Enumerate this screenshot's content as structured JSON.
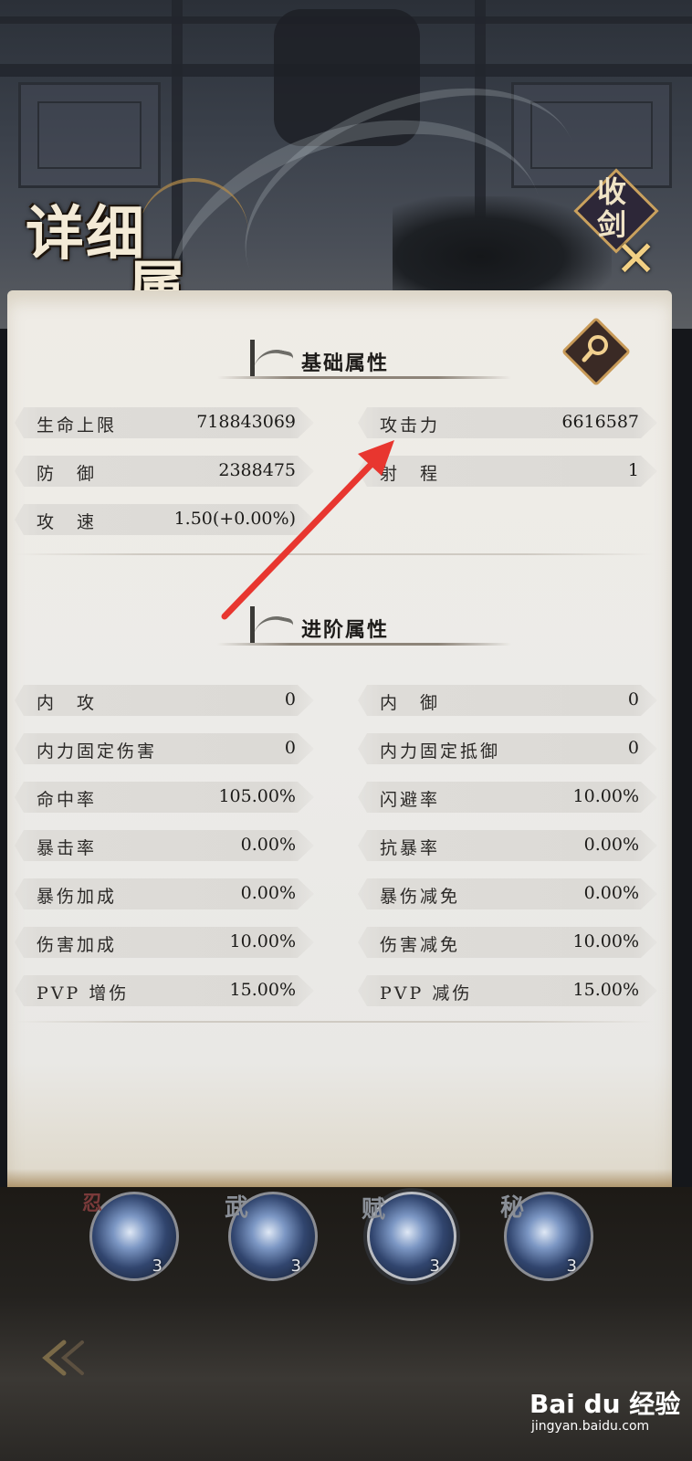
{
  "header": {
    "title_line1": "详细",
    "title_line2": "属性",
    "collapse_label": "收剑"
  },
  "basic": {
    "section_title": "基础属性",
    "rows": [
      {
        "label": "生命上限",
        "value": "718843069"
      },
      {
        "label": "攻击力",
        "value": "6616587"
      },
      {
        "label": "防　御",
        "value": "2388475"
      },
      {
        "label": "射　程",
        "value": "1"
      },
      {
        "label": "攻　速",
        "value": "1.50(+0.00%)"
      }
    ]
  },
  "advanced": {
    "section_title": "进阶属性",
    "rows": [
      {
        "label": "内　攻",
        "value": "0"
      },
      {
        "label": "内　御",
        "value": "0"
      },
      {
        "label": "内力固定伤害",
        "value": "0"
      },
      {
        "label": "内力固定抵御",
        "value": "0"
      },
      {
        "label": "命中率",
        "value": "105.00%"
      },
      {
        "label": "闪避率",
        "value": "10.00%"
      },
      {
        "label": "暴击率",
        "value": "0.00%"
      },
      {
        "label": "抗暴率",
        "value": "0.00%"
      },
      {
        "label": "暴伤加成",
        "value": "0.00%"
      },
      {
        "label": "暴伤减免",
        "value": "0.00%"
      },
      {
        "label": "伤害加成",
        "value": "10.00%"
      },
      {
        "label": "伤害减免",
        "value": "10.00%"
      },
      {
        "label": "PVP 增伤",
        "value": "15.00%"
      },
      {
        "label": "PVP 减伤",
        "value": "15.00%"
      }
    ]
  },
  "skills": [
    {
      "tag": "忍",
      "level": "3"
    },
    {
      "tag": "武",
      "level": "3"
    },
    {
      "tag": "赋",
      "level": "3"
    },
    {
      "tag": "秘",
      "level": "3"
    }
  ],
  "watermark": {
    "main": "Bai du 经验",
    "sub": "jingyan.baidu.com"
  },
  "colors": {
    "accent_gold": "#c89a57",
    "annotation_arrow": "#e8362f",
    "paper": "#ecebe8"
  }
}
